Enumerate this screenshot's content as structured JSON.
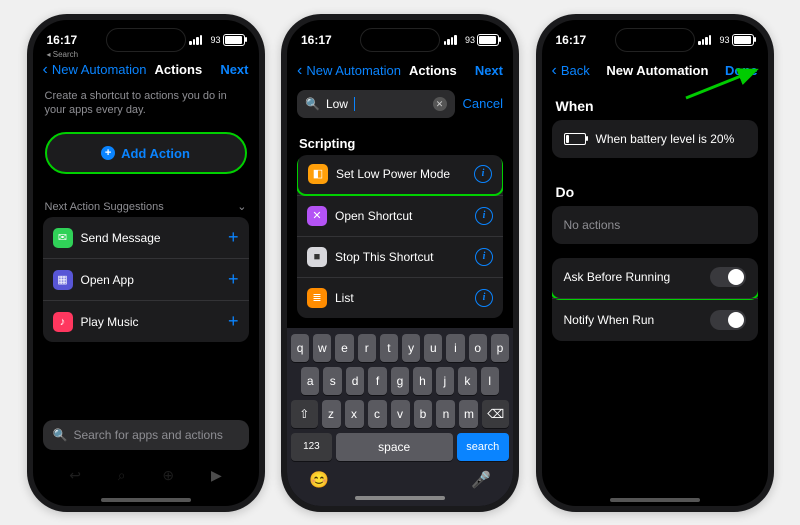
{
  "status": {
    "time": "16:17",
    "back_label": "Search",
    "battery_pct": "93",
    "battery_fill_pct": 90
  },
  "phone1": {
    "nav_back": "New Automation",
    "nav_title": "Actions",
    "nav_right": "Next",
    "desc": "Create a shortcut to actions you do in your apps every day.",
    "add_action": "Add Action",
    "suggestions_header": "Next Action Suggestions",
    "suggestions": [
      {
        "label": "Send Message",
        "icon_color": "#30d158",
        "icon_glyph": "✉"
      },
      {
        "label": "Open App",
        "icon_color": "#5856d6",
        "icon_glyph": "▦"
      },
      {
        "label": "Play Music",
        "icon_color": "#ff375f",
        "icon_glyph": "♪"
      }
    ],
    "search_placeholder": "Search for apps and actions",
    "bottom_icons": [
      "↩",
      "⌕",
      "⊕",
      "▶"
    ]
  },
  "phone2": {
    "nav_back": "New Automation",
    "nav_title": "Actions",
    "nav_right": "Next",
    "search_value": "Low",
    "cancel_label": "Cancel",
    "section": "Scripting",
    "items": [
      {
        "label": "Set Low Power Mode",
        "icon_color": "#ff9f0a",
        "highlight": true,
        "glyph": "◧"
      },
      {
        "label": "Open Shortcut",
        "icon_color": "#b453f5",
        "highlight": false,
        "glyph": "✕"
      },
      {
        "label": "Stop This Shortcut",
        "icon_color": "#d7d7dc",
        "highlight": false,
        "glyph": "■"
      },
      {
        "label": "List",
        "icon_color": "#ff8c00",
        "highlight": false,
        "glyph": "≣"
      }
    ],
    "keyboard": {
      "row1": [
        "q",
        "w",
        "e",
        "r",
        "t",
        "y",
        "u",
        "i",
        "o",
        "p"
      ],
      "row2": [
        "a",
        "s",
        "d",
        "f",
        "g",
        "h",
        "j",
        "k",
        "l"
      ],
      "row3_shift": "⇧",
      "row3": [
        "z",
        "x",
        "c",
        "v",
        "b",
        "n",
        "m"
      ],
      "row3_del": "⌫",
      "row4_123": "123",
      "row4_space": "space",
      "row4_search": "search",
      "emoji": "😊",
      "mic": "🎤"
    }
  },
  "phone3": {
    "nav_back": "Back",
    "nav_title": "New Automation",
    "nav_right": "Done",
    "when_label": "When",
    "when_item": "When battery level is 20%",
    "do_label": "Do",
    "do_item": "No actions",
    "options": [
      {
        "label": "Ask Before Running",
        "on": true,
        "highlight": true
      },
      {
        "label": "Notify When Run",
        "on": true,
        "highlight": false
      }
    ]
  }
}
